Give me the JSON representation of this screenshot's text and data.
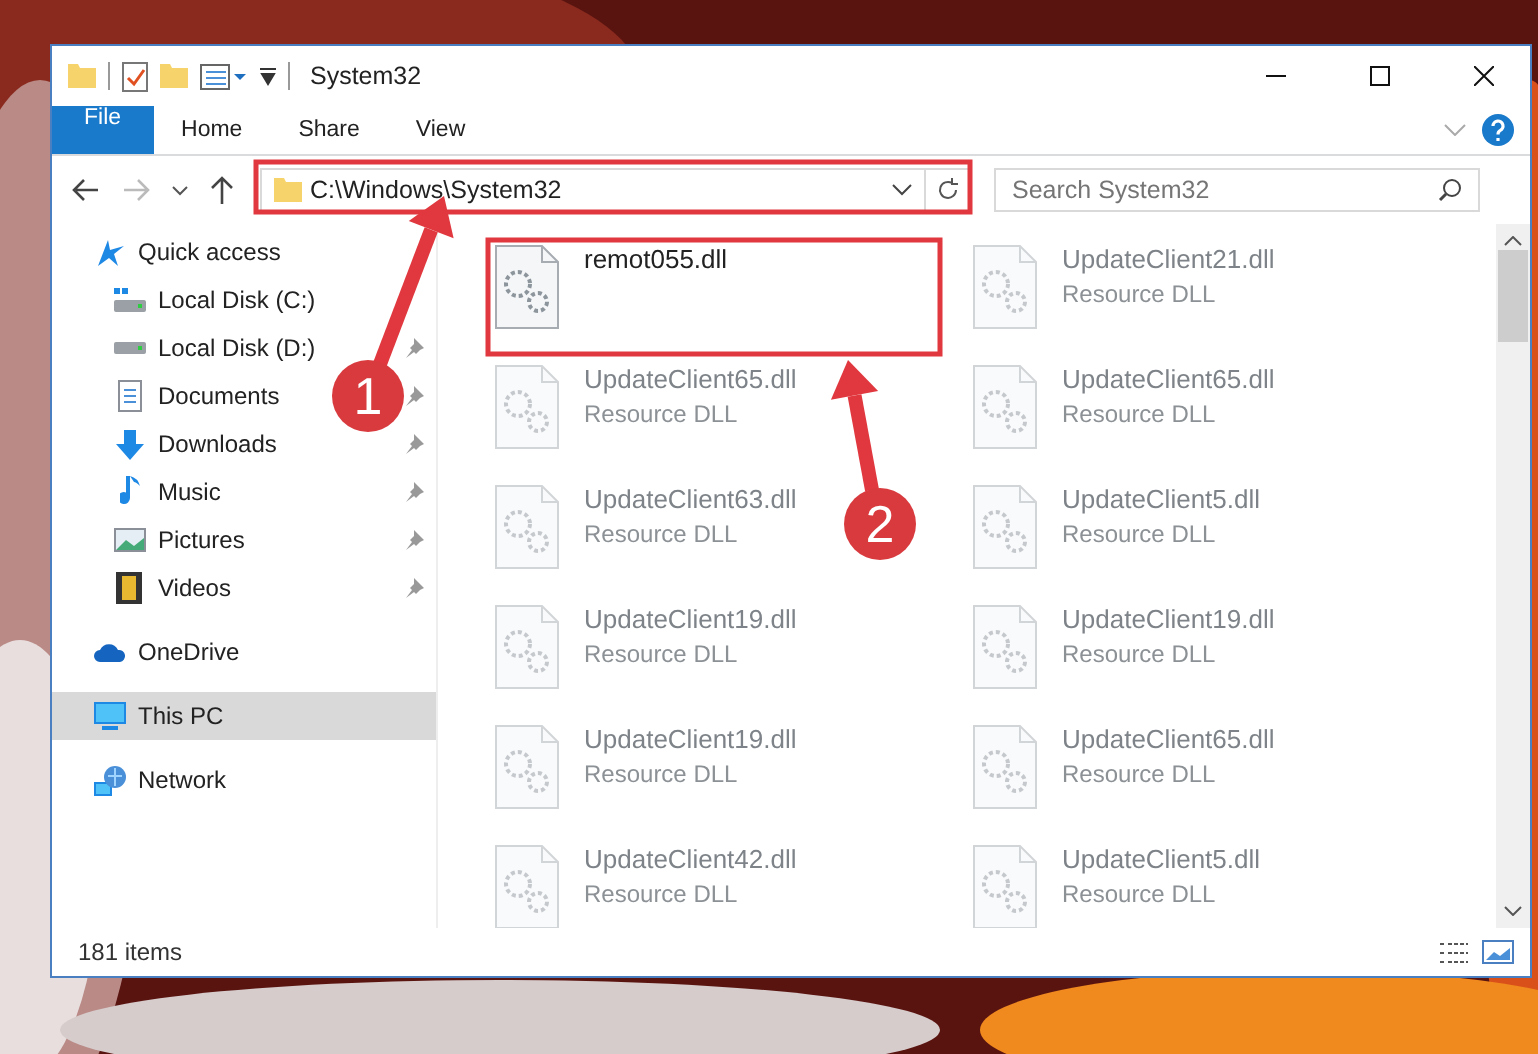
{
  "window": {
    "title": "System32"
  },
  "ribbon_tabs": [
    {
      "label": "File"
    },
    {
      "label": "Home"
    },
    {
      "label": "Share"
    },
    {
      "label": "View"
    }
  ],
  "address": {
    "value": "C:\\Windows\\System32"
  },
  "search": {
    "placeholder": "Search System32"
  },
  "nav": [
    {
      "label": "Quick access",
      "selected": false,
      "children": [
        {
          "label": "Local Disk (C:)",
          "pinned": false,
          "selected": false
        },
        {
          "label": "Local Disk (D:)",
          "pinned": true,
          "selected": false
        },
        {
          "label": "Documents",
          "pinned": true,
          "selected": false
        },
        {
          "label": "Downloads",
          "pinned": true,
          "selected": false
        },
        {
          "label": "Music",
          "pinned": true,
          "selected": false
        },
        {
          "label": "Pictures",
          "pinned": true,
          "selected": false
        },
        {
          "label": "Videos",
          "pinned": true,
          "selected": false
        }
      ]
    },
    {
      "label": "OneDrive",
      "selected": false
    },
    {
      "label": "This PC",
      "selected": true
    },
    {
      "label": "Network",
      "selected": false
    }
  ],
  "files": [
    {
      "name": "remot055.dll"
    },
    {
      "name": "UpdateClient21.dll",
      "type": "Resource DLL"
    },
    {
      "name": "UpdateClient65.dll",
      "type": "Resource DLL"
    },
    {
      "name": "UpdateClient65.dll",
      "type": "Resource DLL"
    },
    {
      "name": "UpdateClient63.dll",
      "type": "Resource DLL"
    },
    {
      "name": "UpdateClient5.dll",
      "type": "Resource DLL"
    },
    {
      "name": "UpdateClient19.dll",
      "type": "Resource DLL"
    },
    {
      "name": "UpdateClient19.dll",
      "type": "Resource DLL"
    },
    {
      "name": "UpdateClient19.dll",
      "type": "Resource DLL"
    },
    {
      "name": "UpdateClient65.dll",
      "type": "Resource DLL"
    },
    {
      "name": "UpdateClient42.dll",
      "type": "Resource DLL"
    },
    {
      "name": "UpdateClient5.dll",
      "type": "Resource DLL"
    }
  ],
  "status_bar": {
    "count": "181 items"
  },
  "annotations": [
    {
      "label": "1"
    },
    {
      "label": "2"
    }
  ]
}
